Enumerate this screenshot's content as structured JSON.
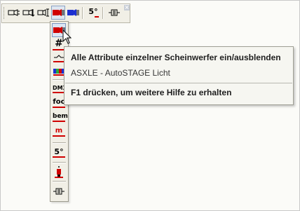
{
  "toolbar": {
    "buttons": [
      {
        "name": "spot-left-icon"
      },
      {
        "name": "spot-down-icon"
      },
      {
        "name": "spot-text-icon"
      },
      {
        "name": "spot-red-icon"
      },
      {
        "name": "spot-blue-icon"
      },
      {
        "name": "focus-5-icon",
        "label": "5°"
      },
      {
        "name": "connector-icon"
      }
    ],
    "close_label": "×"
  },
  "dropdown": {
    "items": [
      {
        "name": "show-hide-all-attributes",
        "icon": "spot-red-icon"
      },
      {
        "name": "number-item",
        "label": "#"
      },
      {
        "name": "tilt-item",
        "icon": "tilt-icon"
      },
      {
        "name": "color-item",
        "icon": "color-bar-icon"
      },
      {
        "name": "dmx-item",
        "label": "DMX"
      },
      {
        "name": "focus-item",
        "label": "foc"
      },
      {
        "name": "remark-item",
        "label": "bem"
      },
      {
        "name": "m-item",
        "label": "m"
      },
      {
        "name": "angle-item",
        "label": "5°"
      },
      {
        "name": "lamp-item",
        "icon": "lamp-icon"
      },
      {
        "name": "connector-item",
        "icon": "connector-icon"
      }
    ]
  },
  "tooltip": {
    "title": "Alle Attribute einzelner Scheinwerfer ein/ausblenden",
    "description": "ASXLE - AutoSTAGE Licht",
    "help": "F1 drücken, um weitere Hilfe zu erhalten"
  },
  "colors": {
    "accent_red": "#d00000",
    "accent_blue": "#1c2fd0",
    "toolbar_bg": "#f1efe6",
    "tooltip_bg": "#f6f6f1"
  }
}
